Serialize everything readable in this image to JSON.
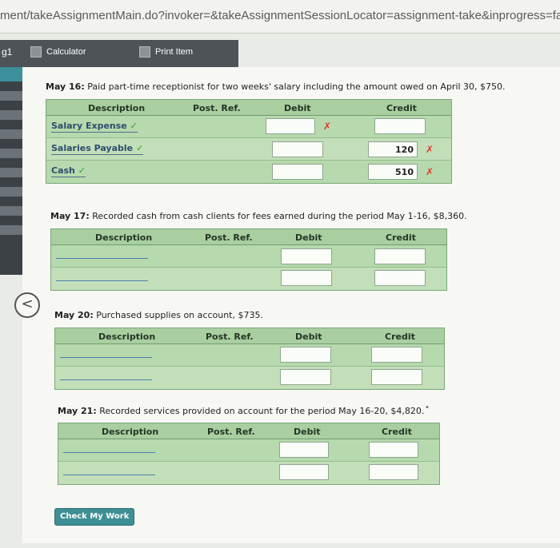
{
  "url": "ment/takeAssignmentMain.do?invoker=&takeAssignmentSessionLocator=assignment-take&inprogress=false",
  "toolbar": {
    "page_number": "g1",
    "calculator_label": "Calculator",
    "print_label": "Print Item"
  },
  "columns": {
    "description": "Description",
    "post_ref": "Post. Ref.",
    "debit": "Debit",
    "credit": "Credit"
  },
  "entries": [
    {
      "date": "May 16:",
      "text": "Paid part-time receptionist for two weeks' salary including the amount owed on April 30, $750.",
      "rows": [
        {
          "account": "Salary Expense",
          "check": "✓",
          "debit": "",
          "credit": "",
          "debit_mark": "✗",
          "credit_mark": ""
        },
        {
          "account": "Salaries Payable",
          "check": "✓",
          "debit": "",
          "credit": "120",
          "debit_mark": "",
          "credit_mark": "✗"
        },
        {
          "account": "Cash",
          "check": "✓",
          "debit": "",
          "credit": "510",
          "debit_mark": "",
          "credit_mark": "✗"
        }
      ]
    },
    {
      "date": "May 17:",
      "text": "Recorded cash from cash clients for fees earned during the period May 1-16, $8,360."
    },
    {
      "date": "May 20:",
      "text": "Purchased supplies on account, $735."
    },
    {
      "date": "May 21:",
      "text": "Recorded services provided on account for the period May 16-20, $4,820."
    }
  ],
  "check_button": "Check My Work",
  "back_icon": "chevron-left-icon"
}
